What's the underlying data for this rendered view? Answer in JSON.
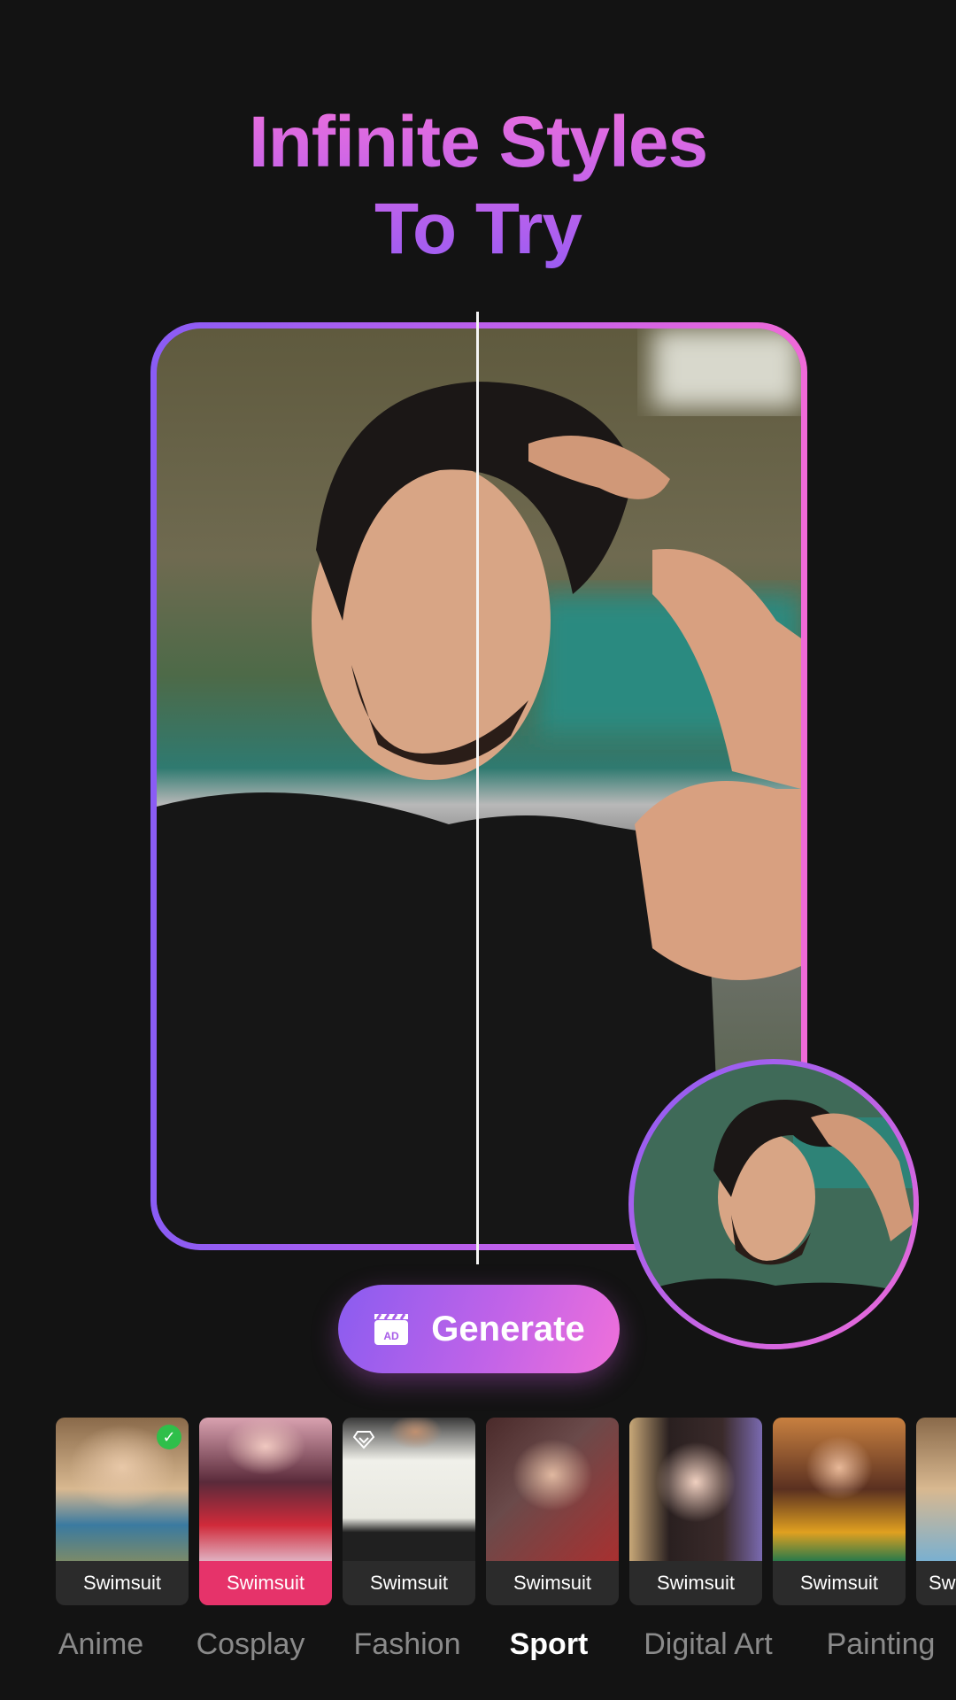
{
  "header": {
    "title_line1": "Infinite Styles",
    "title_line2": "To Try"
  },
  "generate_button": {
    "label": "Generate",
    "icon": "ad-clapperboard-icon",
    "icon_text": "AD"
  },
  "styles": [
    {
      "label": "Swimsuit",
      "selected": false,
      "checked": true,
      "premium": false,
      "colors": [
        "#8a6a4a",
        "#d8b890",
        "#3a7aa0"
      ]
    },
    {
      "label": "Swimsuit",
      "selected": true,
      "checked": false,
      "premium": false,
      "colors": [
        "#d9a2b0",
        "#5a2a3a",
        "#d02a3a"
      ]
    },
    {
      "label": "Swimsuit",
      "selected": false,
      "checked": false,
      "premium": true,
      "colors": [
        "#3a3a3a",
        "#f0f0ea",
        "#202020"
      ]
    },
    {
      "label": "Swimsuit",
      "selected": false,
      "checked": false,
      "premium": false,
      "colors": [
        "#4a2a2a",
        "#e0b8a0",
        "#a83030"
      ]
    },
    {
      "label": "Swimsuit",
      "selected": false,
      "checked": false,
      "premium": false,
      "colors": [
        "#c8a878",
        "#f0d0c0",
        "#7a6ab0"
      ]
    },
    {
      "label": "Swimsuit",
      "selected": false,
      "checked": false,
      "premium": false,
      "colors": [
        "#c88040",
        "#e8b898",
        "#e0a020"
      ]
    },
    {
      "label": "Sw",
      "selected": false,
      "checked": false,
      "premium": false,
      "colors": [
        "#8a6a4a",
        "#d8b890",
        "#7ab0d0"
      ]
    }
  ],
  "categories": [
    {
      "label": "Anime",
      "active": false
    },
    {
      "label": "Cosplay",
      "active": false
    },
    {
      "label": "Fashion",
      "active": false
    },
    {
      "label": "Sport",
      "active": true
    },
    {
      "label": "Digital Art",
      "active": false
    },
    {
      "label": "Painting",
      "active": false
    }
  ],
  "colors": {
    "accent_purple": "#8a5cf5",
    "accent_pink": "#f06ad8",
    "selected_tile": "#e6336a",
    "check_green": "#2fbf4a",
    "background": "#131313"
  }
}
